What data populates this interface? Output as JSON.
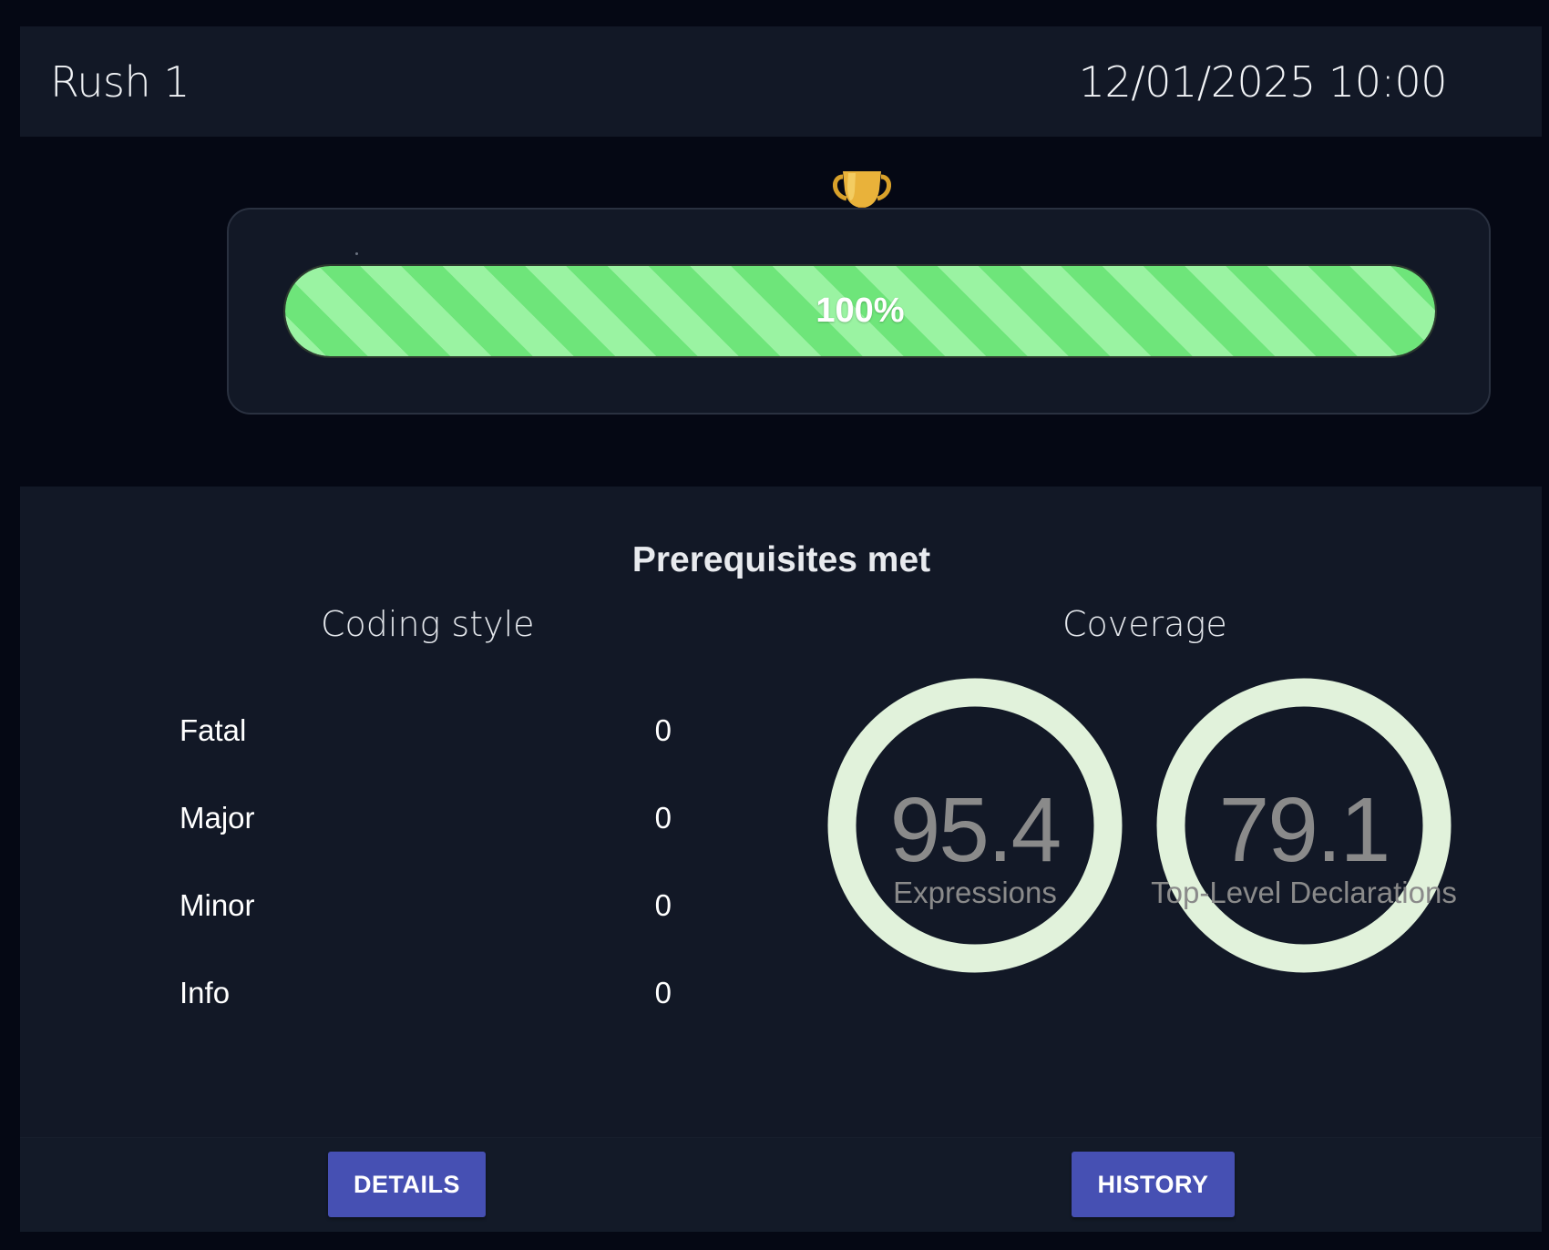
{
  "header": {
    "title": "Rush 1",
    "datetime": "12/01/2025 10:00"
  },
  "progress": {
    "value": 1.0,
    "label": "100%",
    "icon": "trophy-icon",
    "colors": {
      "stripe_light": "#9af3a2",
      "stripe_dark": "#6ee57a"
    }
  },
  "results": {
    "status_title": "Prerequisites met",
    "coding_style": {
      "title": "Coding style",
      "rows": [
        {
          "label": "Fatal",
          "count": "0"
        },
        {
          "label": "Major",
          "count": "0"
        },
        {
          "label": "Minor",
          "count": "0"
        },
        {
          "label": "Info",
          "count": "0"
        }
      ]
    },
    "coverage": {
      "title": "Coverage",
      "gauges": [
        {
          "value": "95.4",
          "percent": 95.4,
          "caption": "Expressions"
        },
        {
          "value": "79.1",
          "percent": 79.1,
          "caption": "Top-Level Declarations"
        }
      ],
      "colors": {
        "filled": "#63c94c",
        "remaining": "#e1f2db"
      }
    }
  },
  "actions": {
    "details_label": "DETAILS",
    "history_label": "HISTORY",
    "button_color": "#4650b3"
  }
}
